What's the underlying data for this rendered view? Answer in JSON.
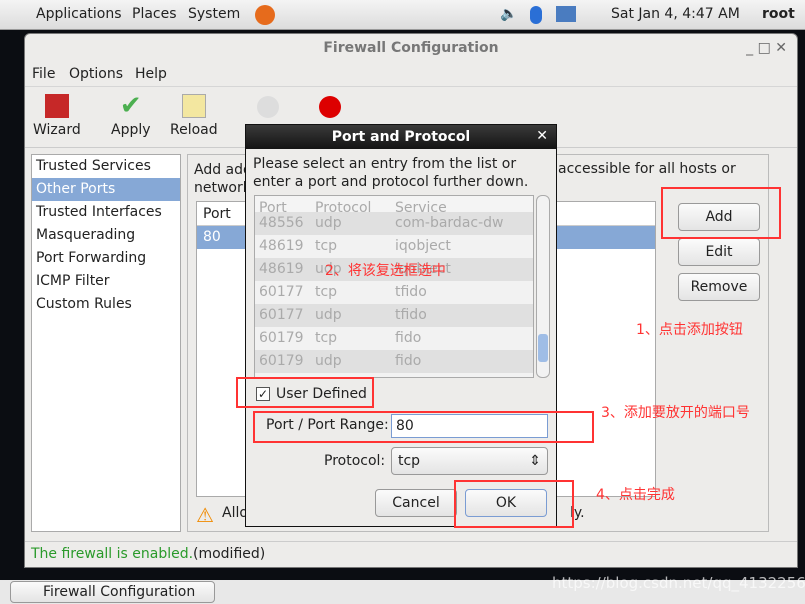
{
  "top_panel": {
    "applications": "Applications",
    "places": "Places",
    "system": "System",
    "clock": "Sat Jan  4,  4:47 AM",
    "user": "root"
  },
  "window": {
    "title": "Firewall Configuration",
    "menu": [
      "File",
      "Options",
      "Help"
    ],
    "toolbar": [
      "Wizard",
      "Apply",
      "Reload"
    ],
    "sidebar": [
      "Trusted Services",
      "Other Ports",
      "Trusted Interfaces",
      "Masquerading",
      "Port Forwarding",
      "ICMP Filter",
      "Custom Rules"
    ],
    "selected_sidebar": "Other Ports",
    "description": "Add additional ports or port ranges, which need to be accessible for all hosts or networks.",
    "desc_visible_left": "Add add",
    "desc_visible_left2": "network",
    "desc_visible_right": "accessible for all hosts or",
    "ports_header": "Port",
    "ports": [
      "80"
    ],
    "buttons": {
      "add": "Add",
      "edit": "Edit",
      "remove": "Remove"
    },
    "warning_left": "Allo",
    "warning_right": "ly.",
    "status_enabled": "The firewall is enabled.",
    "status_modified": "(modified)"
  },
  "dialog": {
    "title": "Port and Protocol",
    "instructions": "Please select an entry from the list or enter a port and protocol further down.",
    "columns": [
      "Port",
      "Protocol",
      "Service"
    ],
    "rows": [
      [
        "48556",
        "udp",
        "com-bardac-dw"
      ],
      [
        "48619",
        "tcp",
        "iqobject"
      ],
      [
        "48619",
        "udp",
        "iqobject"
      ],
      [
        "60177",
        "tcp",
        "tfido"
      ],
      [
        "60177",
        "udp",
        "tfido"
      ],
      [
        "60179",
        "tcp",
        "fido"
      ],
      [
        "60179",
        "udp",
        "fido"
      ]
    ],
    "user_defined_label": "User Defined",
    "user_defined_checked": true,
    "port_label": "Port / Port Range:",
    "port_value": "80",
    "protocol_label": "Protocol:",
    "protocol_value": "tcp",
    "cancel": "Cancel",
    "ok": "OK"
  },
  "annotations": {
    "a1": "1、点击添加按钮",
    "a2": "2、将该复选框选中",
    "a3": "3、添加要放开的端口号",
    "a4": "4、点击完成",
    "color": "#ff3333"
  },
  "taskbar": {
    "item": "Firewall Configuration",
    "watermark": "https://blog.csdn.net/qq_41322565"
  }
}
